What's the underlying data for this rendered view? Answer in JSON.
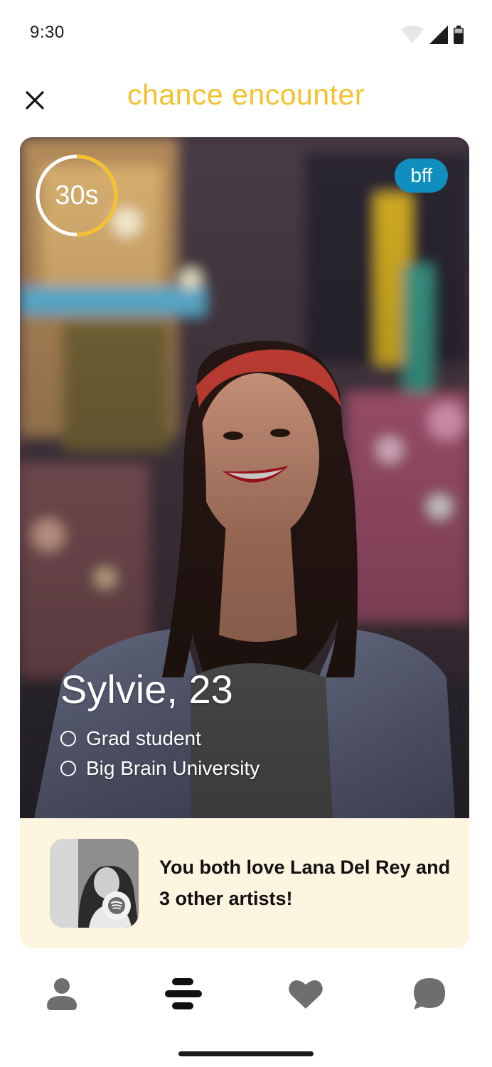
{
  "status_bar": {
    "time": "9:30",
    "icons": [
      "wifi-icon",
      "cellular-signal-icon",
      "battery-icon"
    ]
  },
  "header": {
    "title": "chance encounter",
    "close_icon": "close-icon",
    "title_color": "#f5c12e"
  },
  "card": {
    "timer": {
      "label": "30s",
      "progress": 0.5,
      "color": "#f5c12e"
    },
    "tag": {
      "label": "bff",
      "color": "#0f8fbf"
    },
    "profile": {
      "name": "Sylvie, 23",
      "details": [
        "Grad student",
        "Big Brain University"
      ]
    },
    "music": {
      "text": "You both love Lana Del Rey and 3 other artists!",
      "badge_icon": "spotify-icon",
      "background": "#fdf5df"
    }
  },
  "bottom_nav": {
    "items": [
      {
        "icon": "profile-icon",
        "active": false
      },
      {
        "icon": "stack-icon",
        "active": true
      },
      {
        "icon": "heart-icon",
        "active": false
      },
      {
        "icon": "chat-icon",
        "active": false
      }
    ],
    "active_color": "#111111",
    "inactive_color": "#6e6e6e"
  }
}
